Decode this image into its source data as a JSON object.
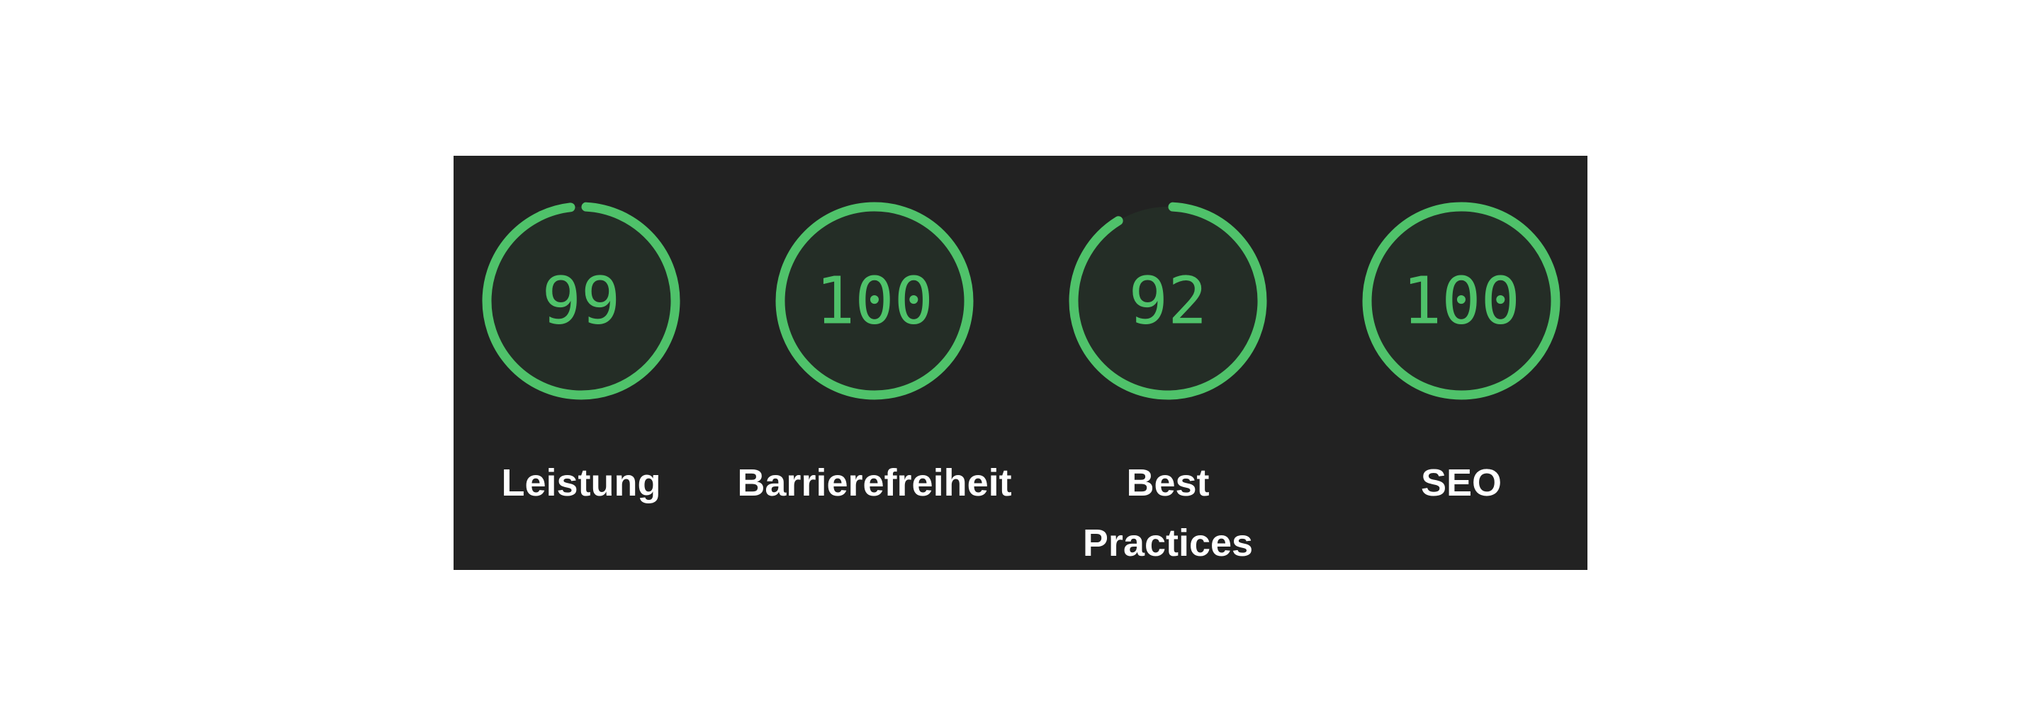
{
  "colors": {
    "background": "#ffffff",
    "panel": "#222222",
    "gauge_fill": "#242d26",
    "gauge_track": "#2a332b",
    "pass_green": "#4fc26a",
    "label_text": "#ffffff"
  },
  "gauges": [
    {
      "score": "99",
      "label_lines": [
        "Leistung"
      ],
      "fraction": 0.99
    },
    {
      "score": "100",
      "label_lines": [
        "Barrierefreiheit"
      ],
      "fraction": 1.0
    },
    {
      "score": "92",
      "label_lines": [
        "Best",
        "Practices"
      ],
      "fraction": 0.92
    },
    {
      "score": "100",
      "label_lines": [
        "SEO"
      ],
      "fraction": 1.0
    }
  ]
}
